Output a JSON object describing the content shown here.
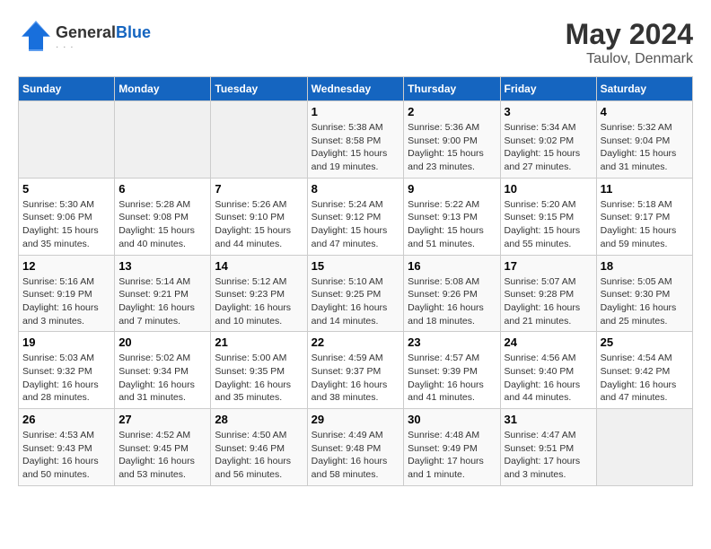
{
  "header": {
    "logo_general": "General",
    "logo_blue": "Blue",
    "month_year": "May 2024",
    "location": "Taulov, Denmark"
  },
  "weekdays": [
    "Sunday",
    "Monday",
    "Tuesday",
    "Wednesday",
    "Thursday",
    "Friday",
    "Saturday"
  ],
  "weeks": [
    [
      {
        "day": "",
        "empty": true
      },
      {
        "day": "",
        "empty": true
      },
      {
        "day": "",
        "empty": true
      },
      {
        "day": "1",
        "sunrise": "5:38 AM",
        "sunset": "8:58 PM",
        "daylight": "15 hours and 19 minutes."
      },
      {
        "day": "2",
        "sunrise": "5:36 AM",
        "sunset": "9:00 PM",
        "daylight": "15 hours and 23 minutes."
      },
      {
        "day": "3",
        "sunrise": "5:34 AM",
        "sunset": "9:02 PM",
        "daylight": "15 hours and 27 minutes."
      },
      {
        "day": "4",
        "sunrise": "5:32 AM",
        "sunset": "9:04 PM",
        "daylight": "15 hours and 31 minutes."
      }
    ],
    [
      {
        "day": "5",
        "sunrise": "5:30 AM",
        "sunset": "9:06 PM",
        "daylight": "15 hours and 35 minutes."
      },
      {
        "day": "6",
        "sunrise": "5:28 AM",
        "sunset": "9:08 PM",
        "daylight": "15 hours and 40 minutes."
      },
      {
        "day": "7",
        "sunrise": "5:26 AM",
        "sunset": "9:10 PM",
        "daylight": "15 hours and 44 minutes."
      },
      {
        "day": "8",
        "sunrise": "5:24 AM",
        "sunset": "9:12 PM",
        "daylight": "15 hours and 47 minutes."
      },
      {
        "day": "9",
        "sunrise": "5:22 AM",
        "sunset": "9:13 PM",
        "daylight": "15 hours and 51 minutes."
      },
      {
        "day": "10",
        "sunrise": "5:20 AM",
        "sunset": "9:15 PM",
        "daylight": "15 hours and 55 minutes."
      },
      {
        "day": "11",
        "sunrise": "5:18 AM",
        "sunset": "9:17 PM",
        "daylight": "15 hours and 59 minutes."
      }
    ],
    [
      {
        "day": "12",
        "sunrise": "5:16 AM",
        "sunset": "9:19 PM",
        "daylight": "16 hours and 3 minutes."
      },
      {
        "day": "13",
        "sunrise": "5:14 AM",
        "sunset": "9:21 PM",
        "daylight": "16 hours and 7 minutes."
      },
      {
        "day": "14",
        "sunrise": "5:12 AM",
        "sunset": "9:23 PM",
        "daylight": "16 hours and 10 minutes."
      },
      {
        "day": "15",
        "sunrise": "5:10 AM",
        "sunset": "9:25 PM",
        "daylight": "16 hours and 14 minutes."
      },
      {
        "day": "16",
        "sunrise": "5:08 AM",
        "sunset": "9:26 PM",
        "daylight": "16 hours and 18 minutes."
      },
      {
        "day": "17",
        "sunrise": "5:07 AM",
        "sunset": "9:28 PM",
        "daylight": "16 hours and 21 minutes."
      },
      {
        "day": "18",
        "sunrise": "5:05 AM",
        "sunset": "9:30 PM",
        "daylight": "16 hours and 25 minutes."
      }
    ],
    [
      {
        "day": "19",
        "sunrise": "5:03 AM",
        "sunset": "9:32 PM",
        "daylight": "16 hours and 28 minutes."
      },
      {
        "day": "20",
        "sunrise": "5:02 AM",
        "sunset": "9:34 PM",
        "daylight": "16 hours and 31 minutes."
      },
      {
        "day": "21",
        "sunrise": "5:00 AM",
        "sunset": "9:35 PM",
        "daylight": "16 hours and 35 minutes."
      },
      {
        "day": "22",
        "sunrise": "4:59 AM",
        "sunset": "9:37 PM",
        "daylight": "16 hours and 38 minutes."
      },
      {
        "day": "23",
        "sunrise": "4:57 AM",
        "sunset": "9:39 PM",
        "daylight": "16 hours and 41 minutes."
      },
      {
        "day": "24",
        "sunrise": "4:56 AM",
        "sunset": "9:40 PM",
        "daylight": "16 hours and 44 minutes."
      },
      {
        "day": "25",
        "sunrise": "4:54 AM",
        "sunset": "9:42 PM",
        "daylight": "16 hours and 47 minutes."
      }
    ],
    [
      {
        "day": "26",
        "sunrise": "4:53 AM",
        "sunset": "9:43 PM",
        "daylight": "16 hours and 50 minutes."
      },
      {
        "day": "27",
        "sunrise": "4:52 AM",
        "sunset": "9:45 PM",
        "daylight": "16 hours and 53 minutes."
      },
      {
        "day": "28",
        "sunrise": "4:50 AM",
        "sunset": "9:46 PM",
        "daylight": "16 hours and 56 minutes."
      },
      {
        "day": "29",
        "sunrise": "4:49 AM",
        "sunset": "9:48 PM",
        "daylight": "16 hours and 58 minutes."
      },
      {
        "day": "30",
        "sunrise": "4:48 AM",
        "sunset": "9:49 PM",
        "daylight": "17 hours and 1 minute."
      },
      {
        "day": "31",
        "sunrise": "4:47 AM",
        "sunset": "9:51 PM",
        "daylight": "17 hours and 3 minutes."
      },
      {
        "day": "",
        "empty": true
      }
    ]
  ],
  "labels": {
    "sunrise_prefix": "Sunrise: ",
    "sunset_prefix": "Sunset: ",
    "daylight_prefix": "Daylight: "
  }
}
